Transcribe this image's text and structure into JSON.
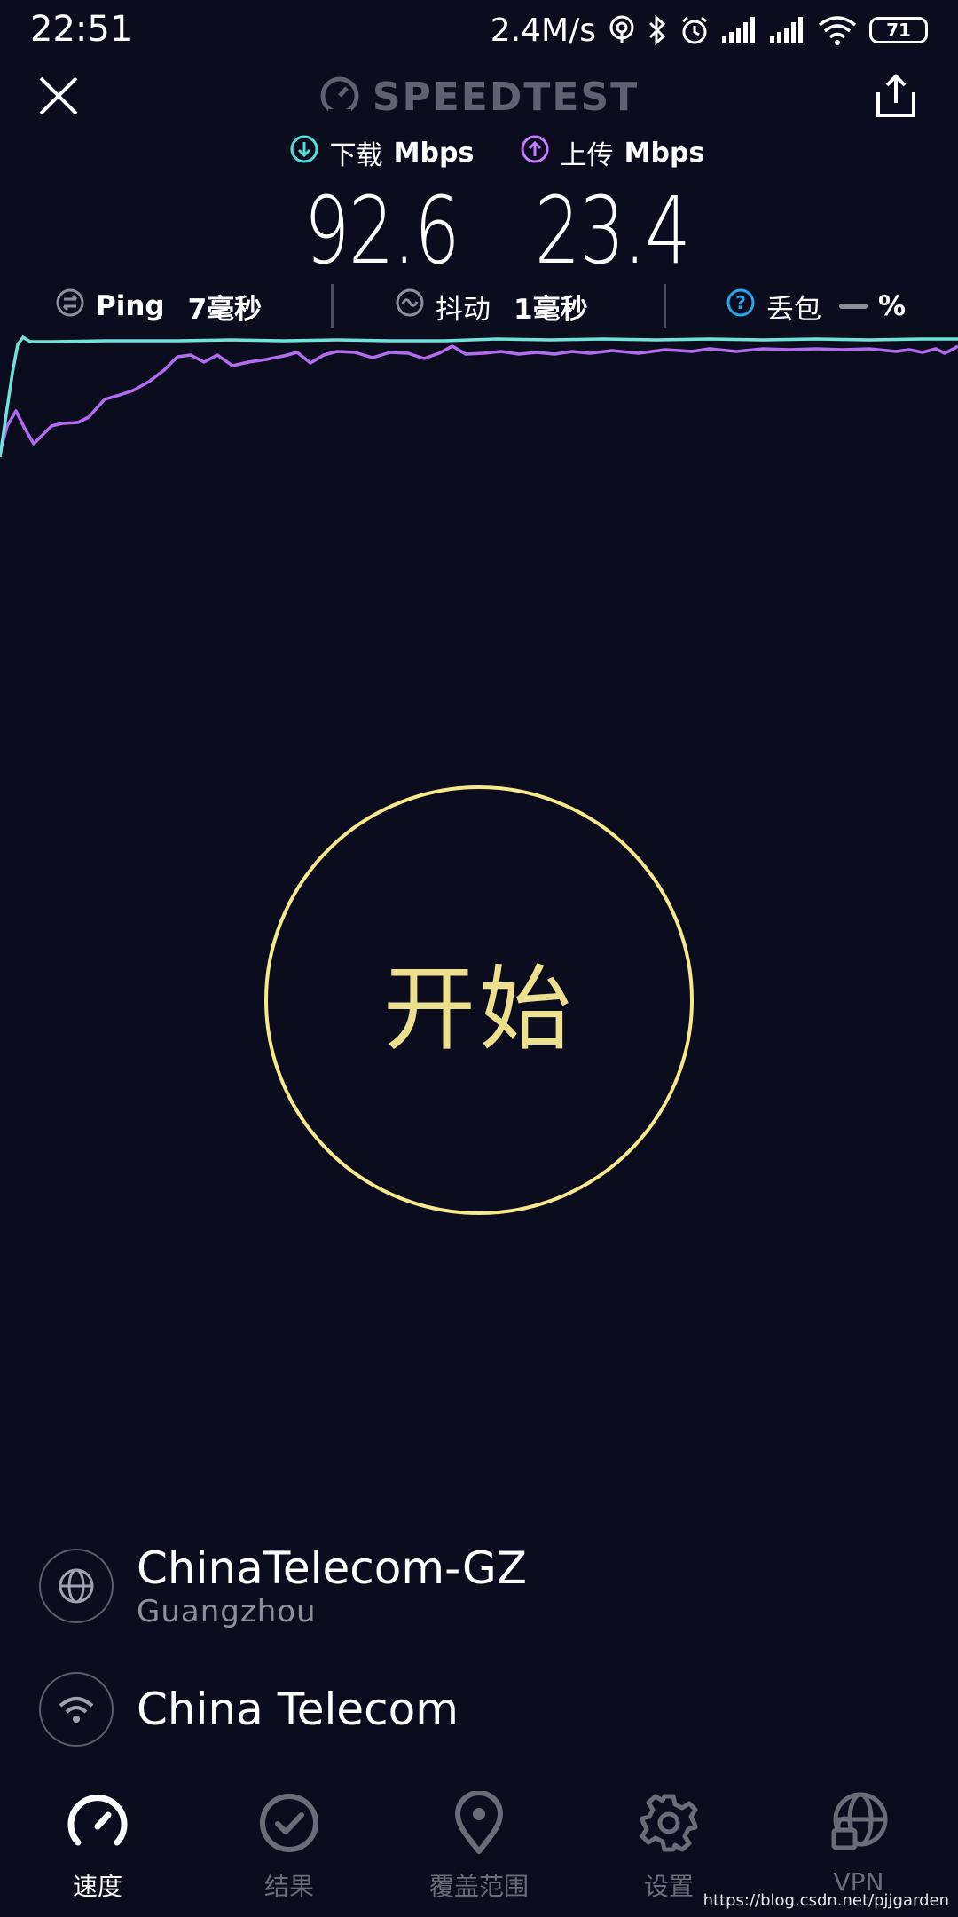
{
  "status_bar": {
    "time": "22:51",
    "net_speed": "2.4M/s",
    "battery": "71",
    "icons": [
      "hotspot-icon",
      "bluetooth-icon",
      "alarm-icon",
      "signal-icon",
      "signal-icon",
      "wifi-icon",
      "battery-icon"
    ]
  },
  "header": {
    "brand": "SPEEDTEST",
    "close_icon": "close-icon",
    "share_icon": "share-icon"
  },
  "download": {
    "label": "下载",
    "unit": "Mbps",
    "value": "92.6",
    "color": "#4fe0d8"
  },
  "upload": {
    "label": "上传",
    "unit": "Mbps",
    "value": "23.4",
    "color": "#c77dff"
  },
  "metrics": {
    "ping": {
      "label": "Ping",
      "value": "7毫秒"
    },
    "jitter": {
      "label": "抖动",
      "value": "1毫秒"
    },
    "packet_loss": {
      "label": "丢包",
      "value": "%"
    }
  },
  "start_button": {
    "label": "开始",
    "color": "#f5e989"
  },
  "server": {
    "name": "ChinaTelecom-GZ",
    "location": "Guangzhou"
  },
  "provider": {
    "name": "China Telecom"
  },
  "nav": {
    "items": [
      {
        "label": "速度",
        "icon": "speedometer-icon",
        "active": true
      },
      {
        "label": "结果",
        "icon": "check-circle-icon",
        "active": false
      },
      {
        "label": "覆盖范围",
        "icon": "map-pin-icon",
        "active": false
      },
      {
        "label": "设置",
        "icon": "gear-icon",
        "active": false
      },
      {
        "label": "VPN",
        "icon": "vpn-globe-lock-icon",
        "active": false
      }
    ]
  },
  "watermark": "https://blog.csdn.net/pjjgarden"
}
